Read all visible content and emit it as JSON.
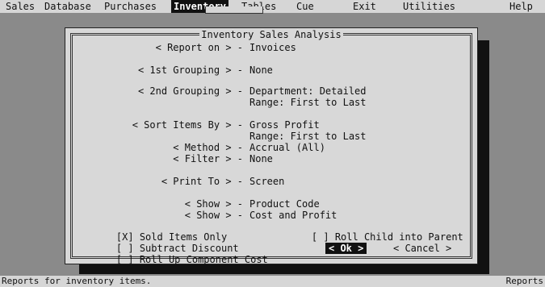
{
  "menu": {
    "items": [
      {
        "label": "Sales"
      },
      {
        "label": "Database"
      },
      {
        "label": "Purchases"
      },
      {
        "label": "Inventory"
      },
      {
        "label": "Tables"
      },
      {
        "label": "Cue"
      },
      {
        "label": "Exit"
      },
      {
        "label": "Utilities"
      },
      {
        "label": "Help"
      }
    ],
    "active": "Inventory"
  },
  "dialog": {
    "title": "Inventory Sales Analysis",
    "report_on": {
      "label": "< Report on > -",
      "value": "Invoices"
    },
    "grouping1": {
      "label": "< 1st Grouping > -",
      "value": "None"
    },
    "grouping2": {
      "label": "< 2nd Grouping > -",
      "value": "Department: Detailed",
      "range": "Range: First to Last"
    },
    "sort_by": {
      "label": "< Sort Items By > -",
      "value": "Gross Profit",
      "range": "Range: First to Last"
    },
    "method": {
      "label": "< Method > -",
      "value": "Accrual (All)"
    },
    "filter": {
      "label": "< Filter > -",
      "value": "None"
    },
    "print_to": {
      "label": "< Print To > -",
      "value": "Screen"
    },
    "show1": {
      "label": "< Show > -",
      "value": "Product Code"
    },
    "show2": {
      "label": "< Show > -",
      "value": "Cost and Profit"
    },
    "checkboxes": {
      "sold_items_only": {
        "mark": "[X]",
        "label": "Sold Items Only"
      },
      "subtract_discount": {
        "mark": "[ ]",
        "label": "Subtract Discount"
      },
      "roll_up": {
        "mark": "[ ]",
        "label": "Roll Up Component Cost"
      },
      "roll_child": {
        "mark": "[ ]",
        "label": "Roll Child into Parent"
      }
    },
    "ok_label": "< Ok >",
    "cancel_label": "< Cancel >"
  },
  "status": {
    "left": "Reports for inventory items.",
    "right": "Reports"
  }
}
